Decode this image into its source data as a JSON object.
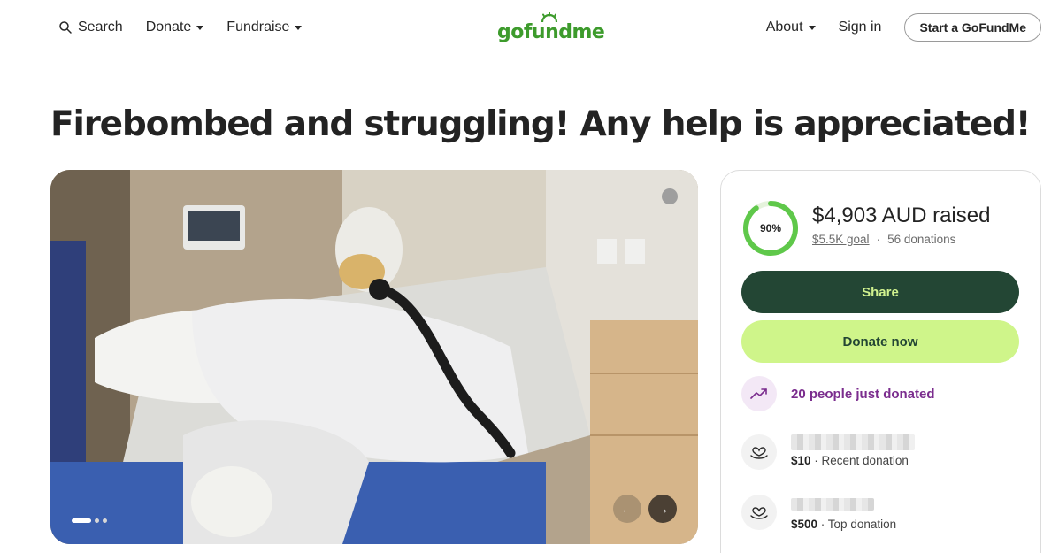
{
  "header": {
    "search_label": "Search",
    "donate_label": "Donate",
    "fundraise_label": "Fundraise",
    "logo_text": "gofundme",
    "about_label": "About",
    "signin_label": "Sign in",
    "start_label": "Start a GoFundMe"
  },
  "campaign": {
    "title": "Firebombed and struggling! Any help is appreciated!"
  },
  "gallery": {
    "slide_count": 3,
    "active_slide": 1,
    "prev_icon": "arrow-left-icon",
    "next_icon": "arrow-right-icon"
  },
  "donation": {
    "progress_percent": 90,
    "progress_label": "90%",
    "raised_text": "$4,903 AUD raised",
    "goal_text": "$5.5K goal",
    "separator": "·",
    "donations_text": "56 donations",
    "share_label": "Share",
    "donate_label": "Donate now",
    "trend_text": "20 people just donated",
    "donors": [
      {
        "amount": "$10",
        "label": " · Recent donation",
        "icon": "heart-hand-icon"
      },
      {
        "amount": "$500",
        "label": " · Top donation",
        "icon": "heart-hand-icon"
      }
    ]
  },
  "colors": {
    "brand_green": "#3d9b2c",
    "dark_green": "#234634",
    "lime": "#cff58a",
    "purple": "#7b2d8e",
    "ring_green": "#5fc84a"
  }
}
